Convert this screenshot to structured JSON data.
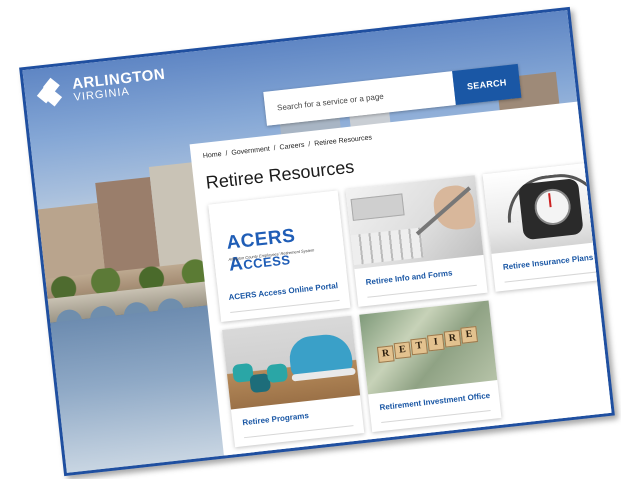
{
  "header": {
    "logo": {
      "line1": "ARLINGTON",
      "line2": "VIRGINIA"
    },
    "search": {
      "placeholder": "Search for a service or a page",
      "button_label": "SEARCH"
    }
  },
  "breadcrumb": [
    "Home",
    "Government",
    "Careers",
    "Retiree Resources"
  ],
  "page": {
    "title": "Retiree Resources"
  },
  "cards": [
    {
      "label": "ACERS Access Online Portal",
      "image_title": "ACERS Access",
      "image_subtitle": "Arlington County Employees' Retirement System"
    },
    {
      "label": "Retiree Info and Forms"
    },
    {
      "label": "Retiree Insurance Plans"
    },
    {
      "label": "Retiree Programs"
    },
    {
      "label": "Retirement Investment Office",
      "tiles": [
        "R",
        "E",
        "T",
        "I",
        "R",
        "E"
      ]
    }
  ],
  "colors": {
    "brand_blue": "#1a57a5",
    "frame_border": "#1f4fa0"
  }
}
